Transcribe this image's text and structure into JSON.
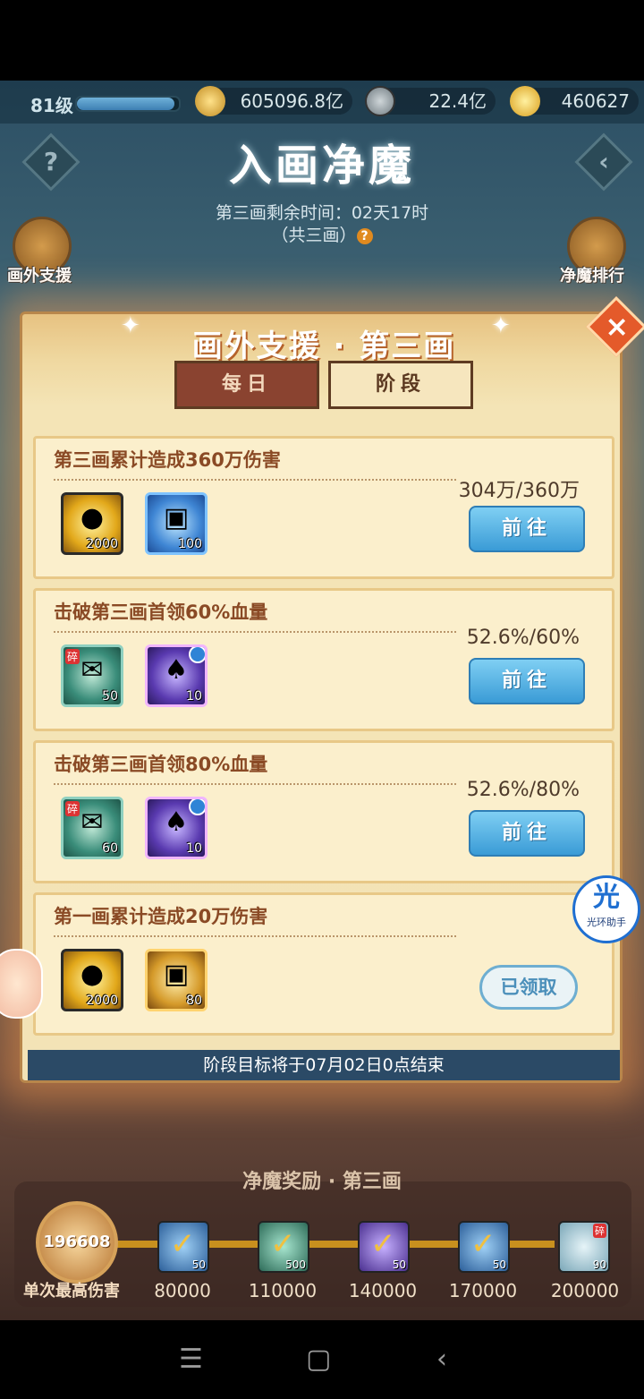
{
  "topbar": {
    "level": "81级",
    "level_progress": 0.96,
    "power": "605096.8亿",
    "power_icon": "battle-power-icon",
    "coins": "22.4亿",
    "coin_icon": "copper-coin-icon",
    "gold": "460627",
    "gold_icon": "gold-ingot-icon"
  },
  "header": {
    "title": "入画净魔",
    "remaining": "第三画剩余时间：02天17时",
    "total": "（共三画）",
    "help": "?"
  },
  "side": {
    "left_label": "画外支援",
    "right_label": "净魔排行"
  },
  "panel": {
    "title": "画外支援 · 第三画",
    "close": "×",
    "tabs": [
      {
        "label": "每日"
      },
      {
        "label": "阶段"
      }
    ],
    "tasks": [
      {
        "title": "第三画累计造成360万伤害",
        "progress": "304万/360万",
        "action": "前往",
        "rewards": [
          {
            "icon": "gold-ingots-icon",
            "count": "2000"
          },
          {
            "icon": "treasure-chest-icon",
            "count": "100"
          }
        ]
      },
      {
        "title": "击破第三画首领60%血量",
        "progress": "52.6%/60%",
        "action": "前往",
        "rewards": [
          {
            "icon": "scroll-fragment-icon",
            "count": "50",
            "tag": "碎"
          },
          {
            "icon": "spirit-icon",
            "count": "10"
          }
        ]
      },
      {
        "title": "击破第三画首领80%血量",
        "progress": "52.6%/80%",
        "action": "前往",
        "rewards": [
          {
            "icon": "scroll-fragment-icon",
            "count": "60",
            "tag": "碎"
          },
          {
            "icon": "spirit-icon",
            "count": "10"
          }
        ]
      },
      {
        "title": "第一画累计造成20万伤害",
        "progress": "",
        "action": "已领取",
        "rewards": [
          {
            "icon": "gold-ingots-icon",
            "count": "2000"
          },
          {
            "icon": "golden-chest-icon",
            "count": "80"
          }
        ]
      }
    ],
    "footer": "阶段目标将于07月02日0点结束"
  },
  "helper": {
    "char": "光",
    "label": "光环助手"
  },
  "bottom": {
    "title": "净魔奖励 · 第三画",
    "max_damage": "196608",
    "max_label": "单次最高伤害",
    "milestones": [
      {
        "value": "80000",
        "count": "50"
      },
      {
        "value": "110000",
        "count": "500"
      },
      {
        "value": "140000",
        "count": "50"
      },
      {
        "value": "170000",
        "count": "50"
      },
      {
        "value": "200000",
        "count": "90",
        "tag": "碎"
      }
    ]
  }
}
